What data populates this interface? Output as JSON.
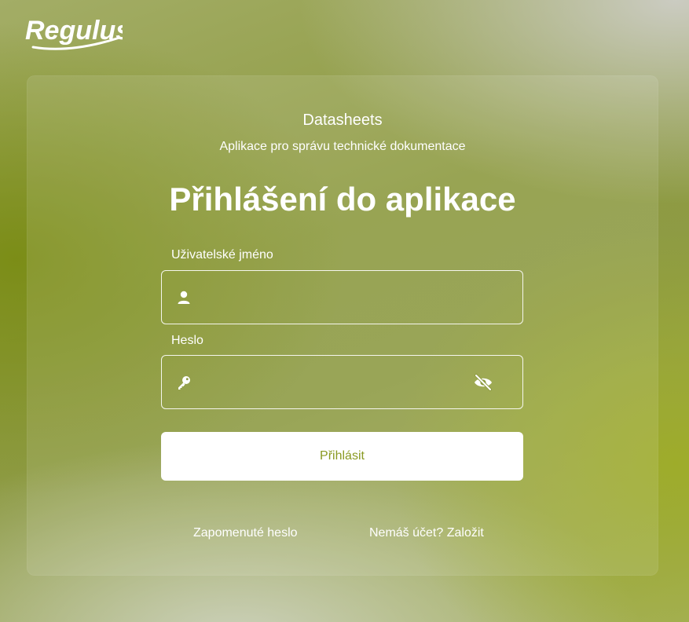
{
  "brand": {
    "logo_text": "Regulus"
  },
  "app": {
    "name": "Datasheets",
    "subtitle": "Aplikace pro správu technické dokumentace"
  },
  "login": {
    "title": "Přihlášení do aplikace",
    "username_label": "Uživatelské jméno",
    "username_value": "",
    "password_label": "Heslo",
    "password_value": "",
    "submit_label": "Přihlásit",
    "forgot_link": "Zapomenuté heslo",
    "register_link": "Nemáš účet? Založit"
  },
  "icons": {
    "username": "user-icon",
    "password": "key-icon",
    "toggle": "eye-slash-icon"
  },
  "colors": {
    "accent": "#8a9a22",
    "background": "#8d9a40",
    "text": "#ffffff"
  }
}
